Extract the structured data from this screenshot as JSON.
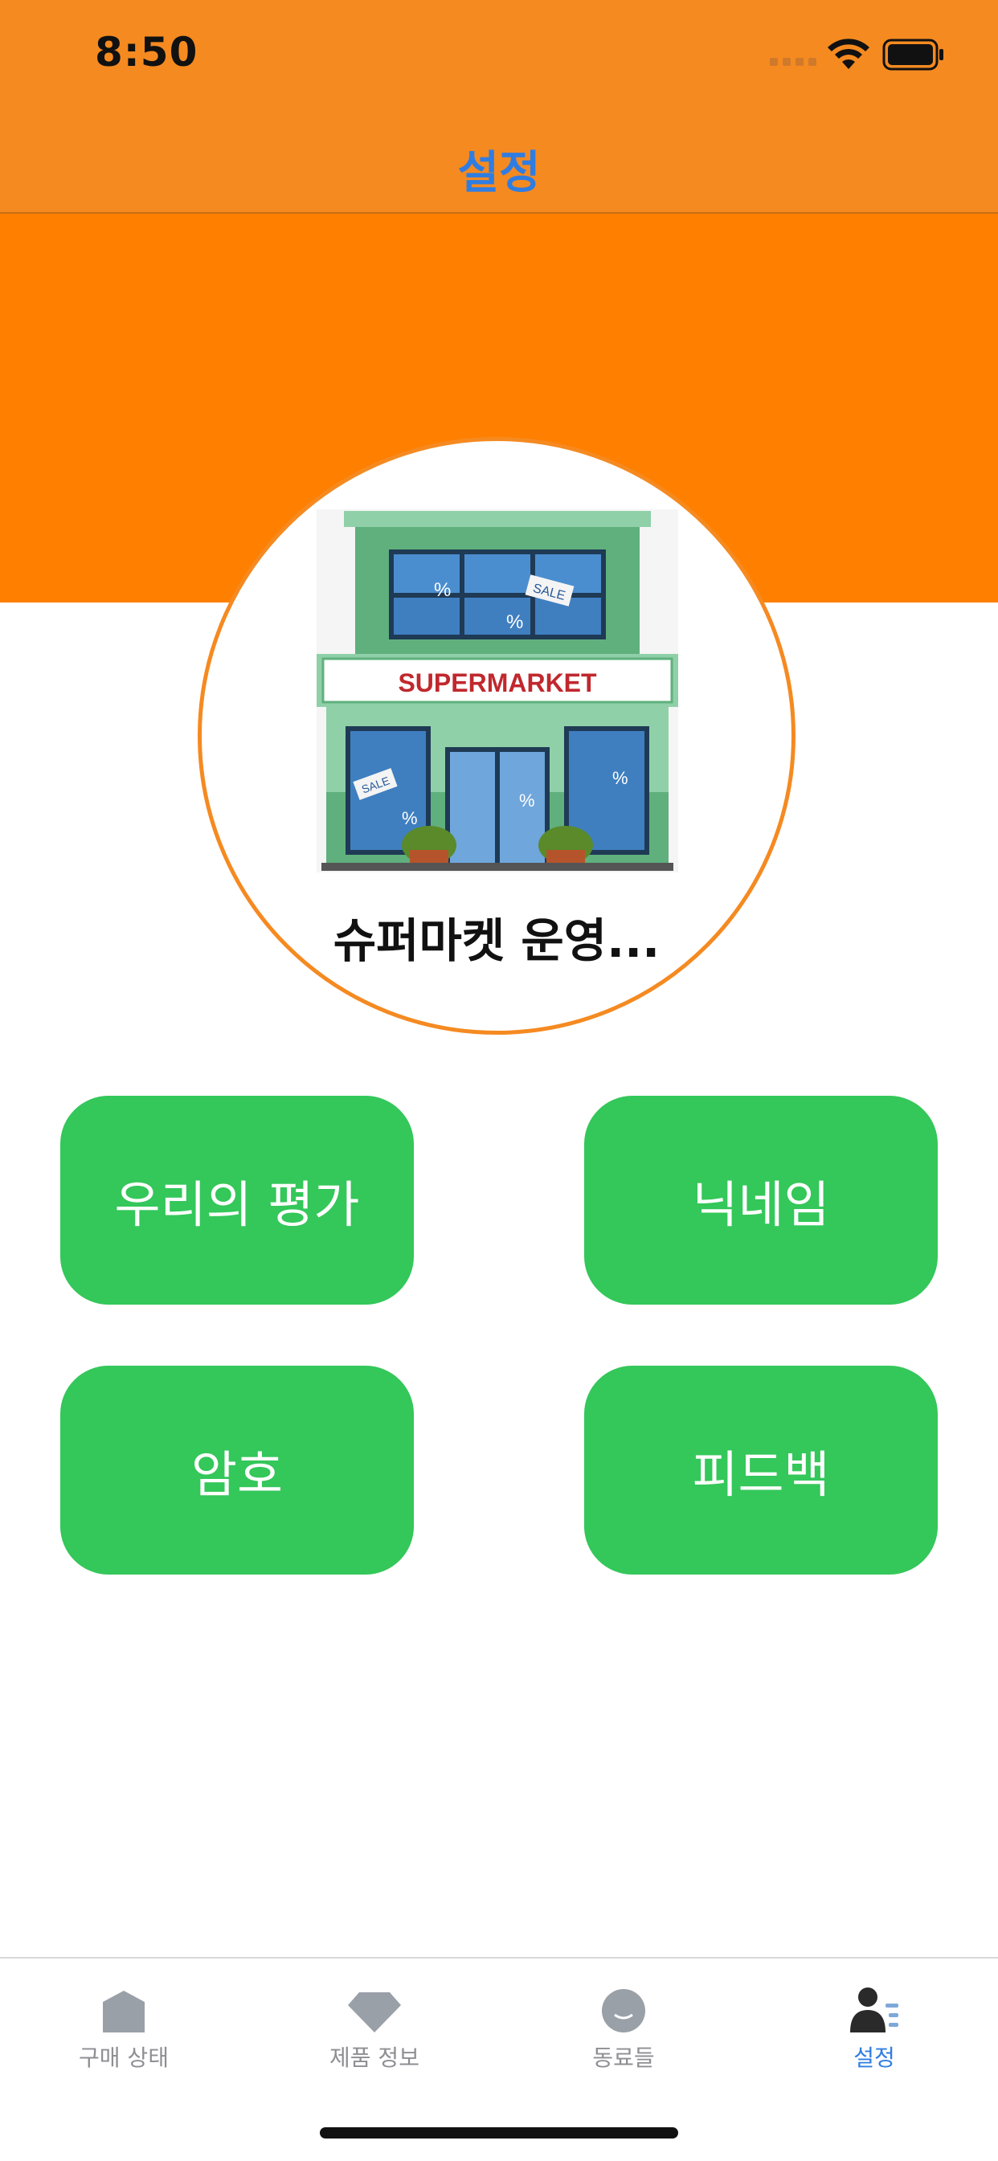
{
  "status_bar": {
    "time": "8:50"
  },
  "nav": {
    "title": "설정"
  },
  "profile": {
    "name": "슈퍼마켓 운영...",
    "store_sign": "SUPERMARKET"
  },
  "buttons": {
    "rating": "우리의 평가",
    "nickname": "닉네임",
    "password": "암호",
    "feedback": "피드백"
  },
  "tabs": [
    {
      "label": "구매 상태",
      "icon": "house-icon"
    },
    {
      "label": "제품 정보",
      "icon": "diamond-icon"
    },
    {
      "label": "동료들",
      "icon": "smiley-icon"
    },
    {
      "label": "설정",
      "icon": "person-settings-icon"
    }
  ],
  "colors": {
    "header": "#f58a21",
    "banner": "#ff7f00",
    "button": "#34c75a",
    "accent": "#2f7de2"
  }
}
